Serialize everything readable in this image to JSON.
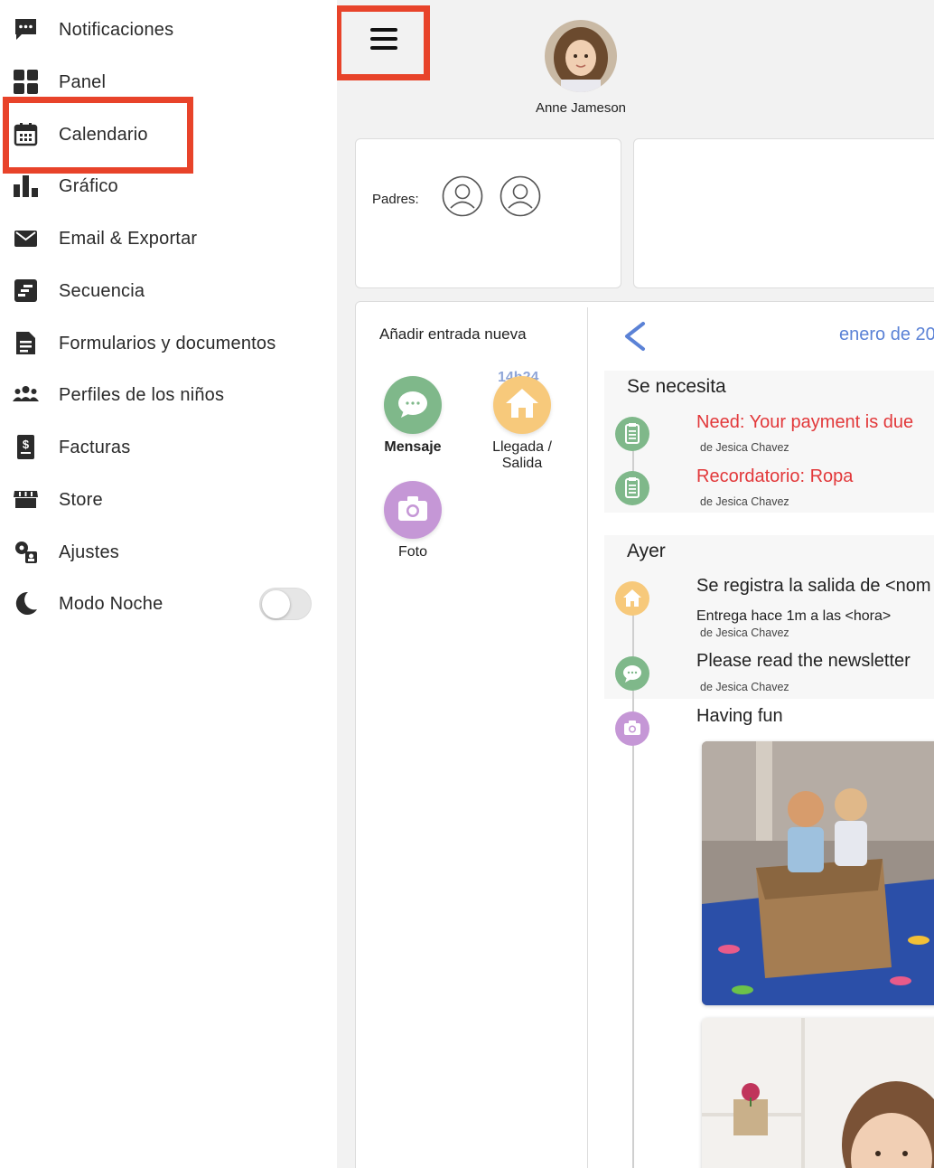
{
  "sidebar": {
    "items": [
      {
        "label": "Notificaciones",
        "icon": "chat-bubble-icon"
      },
      {
        "label": "Panel",
        "icon": "dashboard-grid-icon"
      },
      {
        "label": "Calendario",
        "icon": "calendar-icon"
      },
      {
        "label": "Gráfico",
        "icon": "bar-chart-icon"
      },
      {
        "label": "Email & Exportar",
        "icon": "envelope-icon"
      },
      {
        "label": "Secuencia",
        "icon": "sequence-icon"
      },
      {
        "label": "Formularios y documentos",
        "icon": "document-icon"
      },
      {
        "label": "Perfiles de los niños",
        "icon": "group-icon"
      },
      {
        "label": "Facturas",
        "icon": "invoice-icon"
      },
      {
        "label": "Store",
        "icon": "store-icon"
      },
      {
        "label": "Ajustes",
        "icon": "settings-icon"
      },
      {
        "label": "Modo Noche",
        "icon": "moon-icon"
      }
    ],
    "night_mode_on": false
  },
  "header": {
    "child_name": "Anne Jameson"
  },
  "parents_card": {
    "label": "Padres:"
  },
  "add_entry": {
    "title": "Añadir entrada nueva",
    "time": "14h24",
    "actions": [
      {
        "label": "Mensaje",
        "color": "#7fb88a"
      },
      {
        "label": "Llegada / Salida",
        "label_line1": "Llegada /",
        "label_line2": "Salida",
        "color": "#f7c97b"
      },
      {
        "label": "Foto",
        "color": "#c597d6"
      }
    ]
  },
  "feed": {
    "month": "enero de 20",
    "sections": [
      {
        "title": "Se necesita",
        "entries": [
          {
            "title": "Need: Your payment is due",
            "by": "de Jesica Chavez"
          },
          {
            "title": "Recordatorio: Ropa",
            "by": "de Jesica Chavez"
          }
        ]
      },
      {
        "title": "Ayer",
        "entries": [
          {
            "title": "Se registra la salida de <nom",
            "sub": "Entrega hace 1m a las <hora>",
            "by": "de Jesica Chavez"
          },
          {
            "title": "Please read the newsletter",
            "by": "de Jesica Chavez"
          },
          {
            "title": "Having fun"
          }
        ]
      }
    ]
  },
  "colors": {
    "highlight": "#e8432a",
    "green": "#7fb88a",
    "orange": "#f7c97b",
    "purple": "#c597d6",
    "alert_red": "#e2383a",
    "link_blue": "#5b82d6"
  }
}
